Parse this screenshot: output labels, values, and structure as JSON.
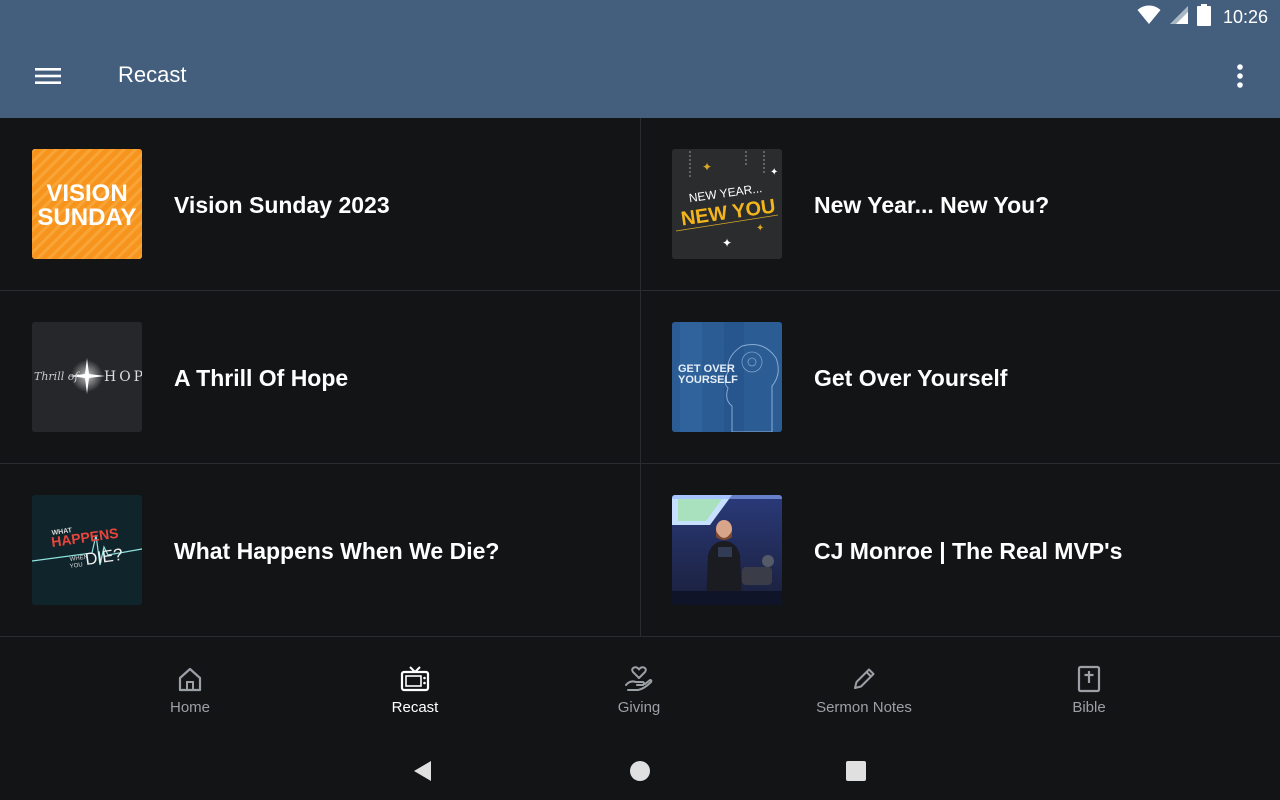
{
  "status_bar": {
    "time": "10:26",
    "icons": [
      "wifi-icon",
      "signal-icon",
      "battery-icon"
    ]
  },
  "app_bar": {
    "title": "Recast",
    "menu_icon": "hamburger-menu-icon",
    "overflow_icon": "more-vertical-icon"
  },
  "items": [
    {
      "title": "Vision Sunday 2023",
      "thumb_text": [
        "VISION",
        "SUNDAY"
      ]
    },
    {
      "title": "New Year... New You?",
      "thumb_text": [
        "NEW YEAR...",
        "NEW YOU"
      ]
    },
    {
      "title": "A Thrill Of Hope",
      "thumb_text": [
        "Thrill of",
        "HOPE"
      ]
    },
    {
      "title": "Get Over Yourself",
      "thumb_text": [
        "GET OVER",
        "YOURSELF"
      ]
    },
    {
      "title": "What Happens When We Die?",
      "thumb_text": [
        "WHAT",
        "HAPPENS",
        "WHEN",
        "YOU",
        "DIE?"
      ]
    },
    {
      "title": "CJ Monroe | The Real MVP's",
      "thumb_text": []
    }
  ],
  "bottom_nav": [
    {
      "label": "Home",
      "icon": "home-icon",
      "active": false
    },
    {
      "label": "Recast",
      "icon": "tv-icon",
      "active": true
    },
    {
      "label": "Giving",
      "icon": "giving-hand-heart-icon",
      "active": false
    },
    {
      "label": "Sermon Notes",
      "icon": "pencil-icon",
      "active": false
    },
    {
      "label": "Bible",
      "icon": "bible-icon",
      "active": false
    }
  ],
  "colors": {
    "app_bar": "#445f7e",
    "background": "#131416",
    "active_nav": "#ffffff",
    "inactive_nav": "#9aa0a6",
    "accent_orange": "#f7941d",
    "accent_gold": "#f2b51c"
  }
}
